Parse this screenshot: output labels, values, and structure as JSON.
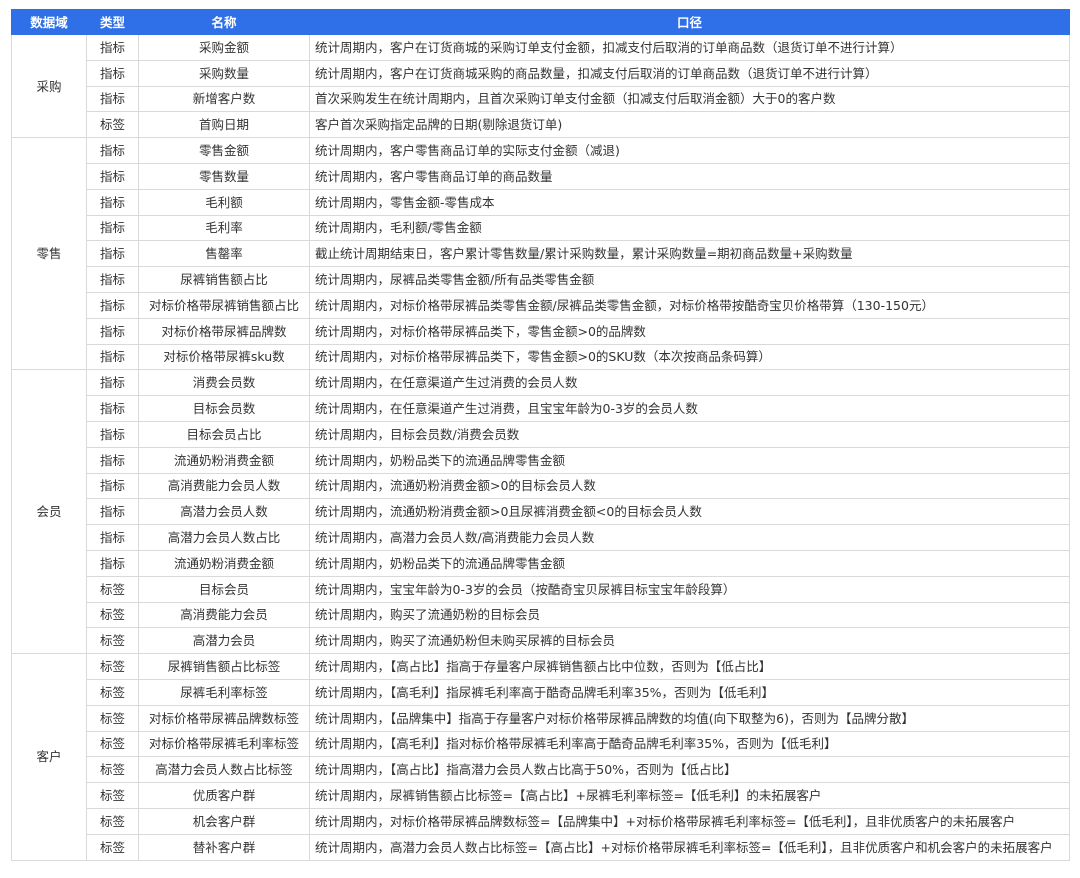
{
  "header": {
    "domain": "数据域",
    "type": "类型",
    "name": "名称",
    "definition": "口径"
  },
  "groups": [
    {
      "domain": "采购",
      "rows": [
        {
          "type": "指标",
          "name": "采购金额",
          "def": "统计周期内，客户在订货商城的采购订单支付金额，扣减支付后取消的订单商品数（退货订单不进行计算）"
        },
        {
          "type": "指标",
          "name": "采购数量",
          "def": "统计周期内，客户在订货商城采购的商品数量，扣减支付后取消的订单商品数（退货订单不进行计算）"
        },
        {
          "type": "指标",
          "name": "新增客户数",
          "def": "首次采购发生在统计周期内，且首次采购订单支付金额（扣减支付后取消金额）大于0的客户数"
        },
        {
          "type": "标签",
          "name": "首购日期",
          "def": "客户首次采购指定品牌的日期(剔除退货订单)"
        }
      ]
    },
    {
      "domain": "零售",
      "rows": [
        {
          "type": "指标",
          "name": "零售金额",
          "def": "统计周期内，客户零售商品订单的实际支付金额（减退)"
        },
        {
          "type": "指标",
          "name": "零售数量",
          "def": "统计周期内，客户零售商品订单的商品数量"
        },
        {
          "type": "指标",
          "name": "毛利额",
          "def": "统计周期内，零售金额-零售成本"
        },
        {
          "type": "指标",
          "name": "毛利率",
          "def": "统计周期内，毛利额/零售金额"
        },
        {
          "type": "指标",
          "name": "售罄率",
          "def": "截止统计周期结束日，客户累计零售数量/累计采购数量，累计采购数量=期初商品数量+采购数量"
        },
        {
          "type": "指标",
          "name": "尿裤销售额占比",
          "def": "统计周期内，尿裤品类零售金额/所有品类零售金额"
        },
        {
          "type": "指标",
          "name": "对标价格带尿裤销售额占比",
          "def": "统计周期内，对标价格带尿裤品类零售金额/尿裤品类零售金额，对标价格带按酷奇宝贝价格带算（130-150元）"
        },
        {
          "type": "指标",
          "name": "对标价格带尿裤品牌数",
          "def": "统计周期内，对标价格带尿裤品类下，零售金额>0的品牌数"
        },
        {
          "type": "指标",
          "name": "对标价格带尿裤sku数",
          "def": "统计周期内，对标价格带尿裤品类下，零售金额>0的SKU数（本次按商品条码算）"
        }
      ]
    },
    {
      "domain": "会员",
      "rows": [
        {
          "type": "指标",
          "name": "消费会员数",
          "def": "统计周期内，在任意渠道产生过消费的会员人数"
        },
        {
          "type": "指标",
          "name": "目标会员数",
          "def": "统计周期内，在任意渠道产生过消费，且宝宝年龄为0-3岁的会员人数"
        },
        {
          "type": "指标",
          "name": "目标会员占比",
          "def": "统计周期内，目标会员数/消费会员数"
        },
        {
          "type": "指标",
          "name": "流通奶粉消费金额",
          "def": "统计周期内，奶粉品类下的流通品牌零售金额"
        },
        {
          "type": "指标",
          "name": "高消费能力会员人数",
          "def": "统计周期内，流通奶粉消费金额>0的目标会员人数"
        },
        {
          "type": "指标",
          "name": "高潜力会员人数",
          "def": "统计周期内，流通奶粉消费金额>0且尿裤消费金额<0的目标会员人数"
        },
        {
          "type": "指标",
          "name": "高潜力会员人数占比",
          "def": "统计周期内，高潜力会员人数/高消费能力会员人数"
        },
        {
          "type": "指标",
          "name": "流通奶粉消费金额",
          "def": "统计周期内，奶粉品类下的流通品牌零售金额"
        },
        {
          "type": "标签",
          "name": "目标会员",
          "def": "统计周期内，宝宝年龄为0-3岁的会员（按酷奇宝贝尿裤目标宝宝年龄段算）"
        },
        {
          "type": "标签",
          "name": "高消费能力会员",
          "def": "统计周期内，购买了流通奶粉的目标会员"
        },
        {
          "type": "标签",
          "name": "高潜力会员",
          "def": "统计周期内，购买了流通奶粉但未购买尿裤的目标会员"
        }
      ]
    },
    {
      "domain": "客户",
      "rows": [
        {
          "type": "标签",
          "name": "尿裤销售额占比标签",
          "def": "统计周期内，【高占比】指高于存量客户尿裤销售额占比中位数，否则为【低占比】"
        },
        {
          "type": "标签",
          "name": "尿裤毛利率标签",
          "def": "统计周期内，【高毛利】指尿裤毛利率高于酷奇品牌毛利率35%，否则为【低毛利】"
        },
        {
          "type": "标签",
          "name": "对标价格带尿裤品牌数标签",
          "def": "统计周期内，【品牌集中】指高于存量客户对标价格带尿裤品牌数的均值(向下取整为6)，否则为【品牌分散】"
        },
        {
          "type": "标签",
          "name": "对标价格带尿裤毛利率标签",
          "def": "统计周期内，【高毛利】指对标价格带尿裤毛利率高于酷奇品牌毛利率35%，否则为【低毛利】"
        },
        {
          "type": "标签",
          "name": "高潜力会员人数占比标签",
          "def": "统计周期内，【高占比】指高潜力会员人数占比高于50%，否则为【低占比】"
        },
        {
          "type": "标签",
          "name": "优质客户群",
          "def": "统计周期内，尿裤销售额占比标签=【高占比】+尿裤毛利率标签=【低毛利】的未拓展客户"
        },
        {
          "type": "标签",
          "name": "机会客户群",
          "def": "统计周期内，对标价格带尿裤品牌数标签=【品牌集中】+对标价格带尿裤毛利率标签=【低毛利】，且非优质客户的未拓展客户"
        },
        {
          "type": "标签",
          "name": "替补客户群",
          "def": "统计周期内，高潜力会员人数占比标签=【高占比】+对标价格带尿裤毛利率标签=【低毛利】，且非优质客户和机会客户的未拓展客户"
        }
      ]
    }
  ]
}
